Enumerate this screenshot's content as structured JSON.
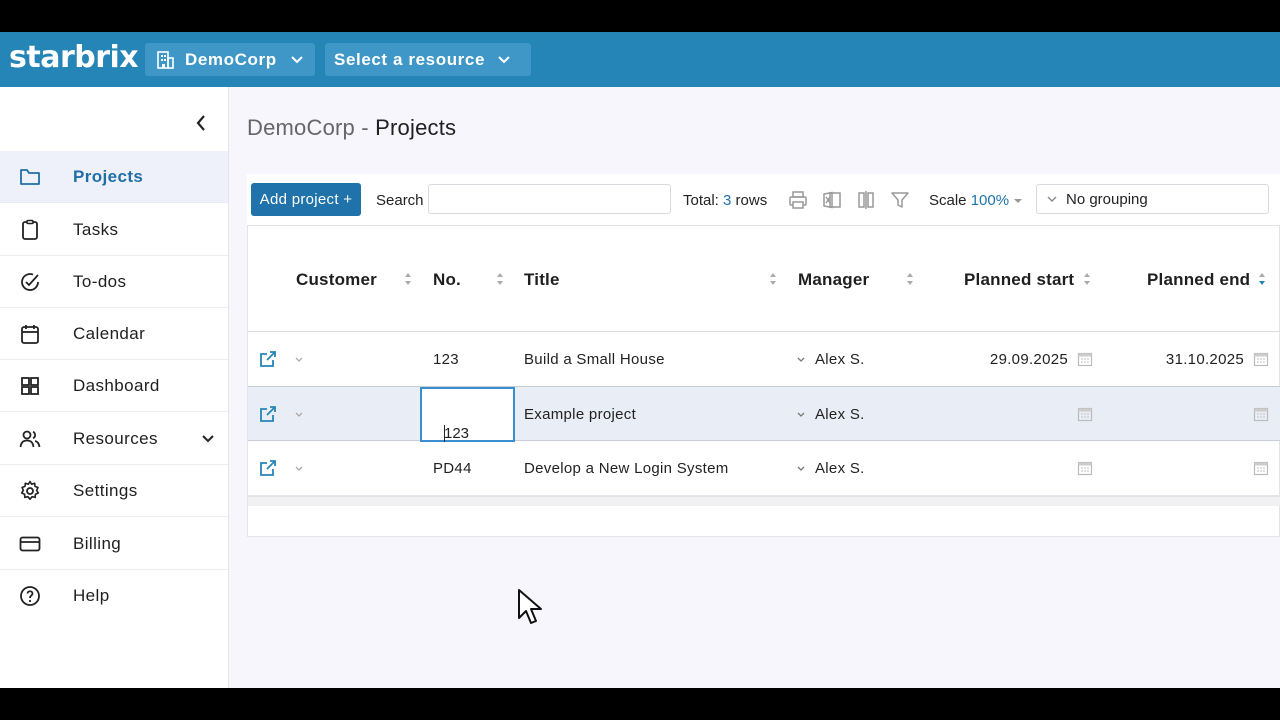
{
  "app": {
    "logo": "starbrix"
  },
  "topbar": {
    "org_label": "DemoCorp",
    "resource_label": "Select a resource"
  },
  "sidebar": {
    "items": [
      {
        "label": "Projects",
        "icon": "folder-icon",
        "active": true
      },
      {
        "label": "Tasks",
        "icon": "clipboard-icon"
      },
      {
        "label": "To-dos",
        "icon": "check-circle-icon"
      },
      {
        "label": "Calendar",
        "icon": "calendar-icon"
      },
      {
        "label": "Dashboard",
        "icon": "grid-icon"
      },
      {
        "label": "Resources",
        "icon": "users-icon",
        "expandable": true
      },
      {
        "label": "Settings",
        "icon": "gear-icon"
      },
      {
        "label": "Billing",
        "icon": "credit-card-icon"
      },
      {
        "label": "Help",
        "icon": "help-circle-icon"
      }
    ]
  },
  "page": {
    "org": "DemoCorp",
    "separator": " - ",
    "title": "Projects"
  },
  "toolbar": {
    "add_label": "Add project +",
    "search_label": "Search",
    "search_value": "",
    "total_prefix": "Total: ",
    "total_count": "3",
    "total_suffix": " rows",
    "scale_label": "Scale ",
    "scale_value": "100%",
    "grouping_value": "No grouping"
  },
  "table": {
    "columns": [
      "Customer",
      "No.",
      "Title",
      "Manager",
      "Planned start",
      "Planned end"
    ],
    "rows": [
      {
        "customer": "",
        "no": "123",
        "title": "Build a Small House",
        "manager": "Alex S.",
        "planned_start": "29.09.2025",
        "planned_end": "31.10.2025"
      },
      {
        "customer": "",
        "no": "123",
        "title": "Example project",
        "manager": "Alex S.",
        "planned_start": "",
        "planned_end": ""
      },
      {
        "customer": "",
        "no": "PD44",
        "title": "Develop a New Login System",
        "manager": "Alex S.",
        "planned_start": "",
        "planned_end": ""
      }
    ]
  },
  "colors": {
    "accent": "#2585b7",
    "button": "#1f72aa",
    "active_bg": "#eef1fa"
  }
}
